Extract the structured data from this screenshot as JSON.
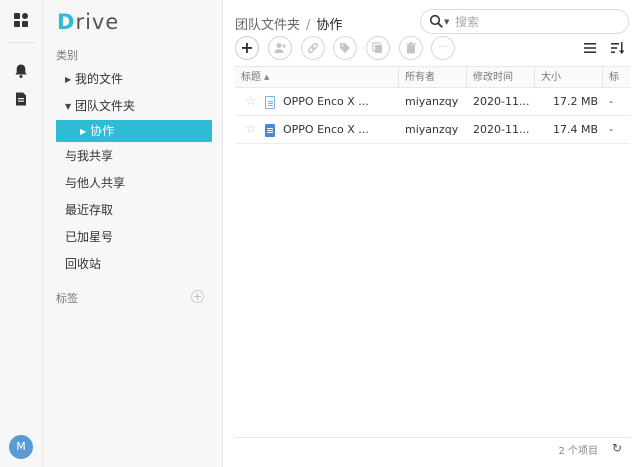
{
  "app": {
    "logo_first": "D",
    "logo_rest": "rive"
  },
  "rail": {
    "icons": [
      "dashboard-icon",
      "bell-icon",
      "note-icon"
    ],
    "avatar": "M"
  },
  "sidebar": {
    "category_label": "类别",
    "items": [
      {
        "label": "我的文件"
      },
      {
        "label": "团队文件夹"
      },
      {
        "label": "协作"
      },
      {
        "label": "与我共享"
      },
      {
        "label": "与他人共享"
      },
      {
        "label": "最近存取"
      },
      {
        "label": "已加星号"
      },
      {
        "label": "回收站"
      }
    ],
    "tags_label": "标签",
    "add_symbol": "+"
  },
  "main": {
    "breadcrumb": {
      "parent": "团队文件夹",
      "separator": "/",
      "current": "协作"
    },
    "search": {
      "placeholder": "搜索",
      "value": ""
    },
    "toolbar": {
      "add_symbol": "+",
      "more_symbol": "···"
    },
    "columns": [
      "标题",
      "所有者",
      "修改时间",
      "大小",
      "标"
    ],
    "rows": [
      {
        "title": "OPPO Enco X ...",
        "owner": "miyanzqy",
        "modified": "2020-11...",
        "size": "17.2 MB",
        "tag": "-"
      },
      {
        "title": "OPPO Enco X ...",
        "owner": "miyanzqy",
        "modified": "2020-11...",
        "size": "17.4 MB",
        "tag": "-"
      }
    ],
    "footer_count": "2 个项目"
  },
  "colors": {
    "accent": "#2ebcd4",
    "doc_blue": "#4a86e8"
  }
}
